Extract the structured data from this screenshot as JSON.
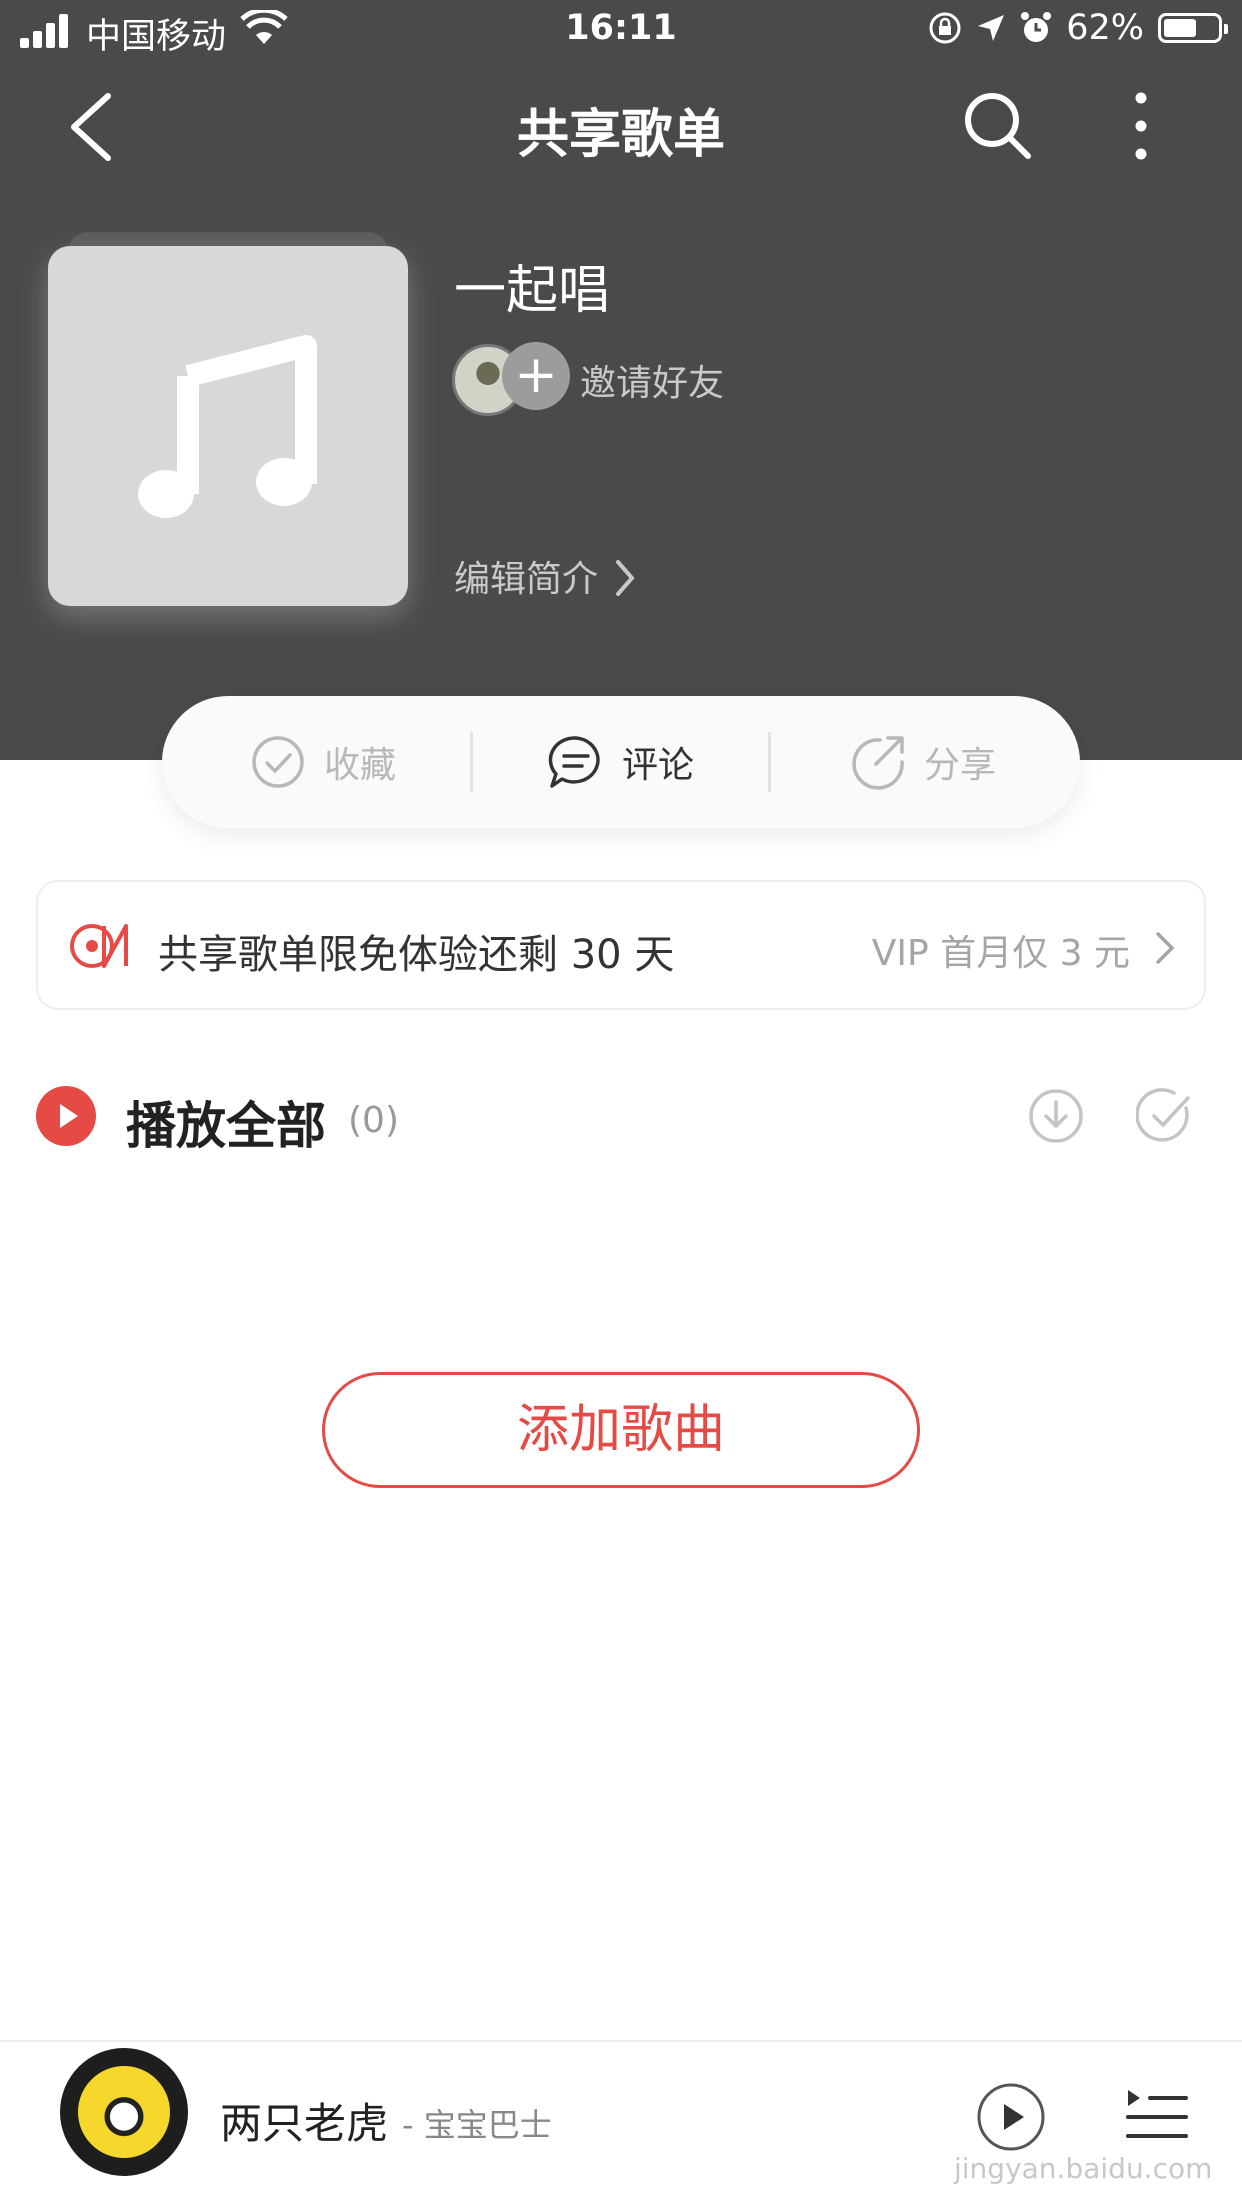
{
  "status_bar": {
    "carrier": "中国移动",
    "time": "16:11",
    "battery": "62%"
  },
  "nav": {
    "title": "共享歌单"
  },
  "playlist": {
    "title": "一起唱",
    "invite_label": "邀请好友",
    "edit_intro_label": "编辑简介"
  },
  "actions": {
    "favorite": "收藏",
    "comment": "评论",
    "share": "分享"
  },
  "vip_banner": {
    "text": "共享歌单限免体验还剩 30 天",
    "cta": "VIP 首月仅 3 元"
  },
  "play_all": {
    "label": "播放全部",
    "count": "(0)"
  },
  "add_songs_label": "添加歌曲",
  "mini_player": {
    "song": "两只老虎",
    "artist": "- 宝宝巴士"
  },
  "watermark": "jingyan.baidu.com",
  "colors": {
    "header_bg": "#4a4a4b",
    "accent_red": "#e64a45"
  }
}
